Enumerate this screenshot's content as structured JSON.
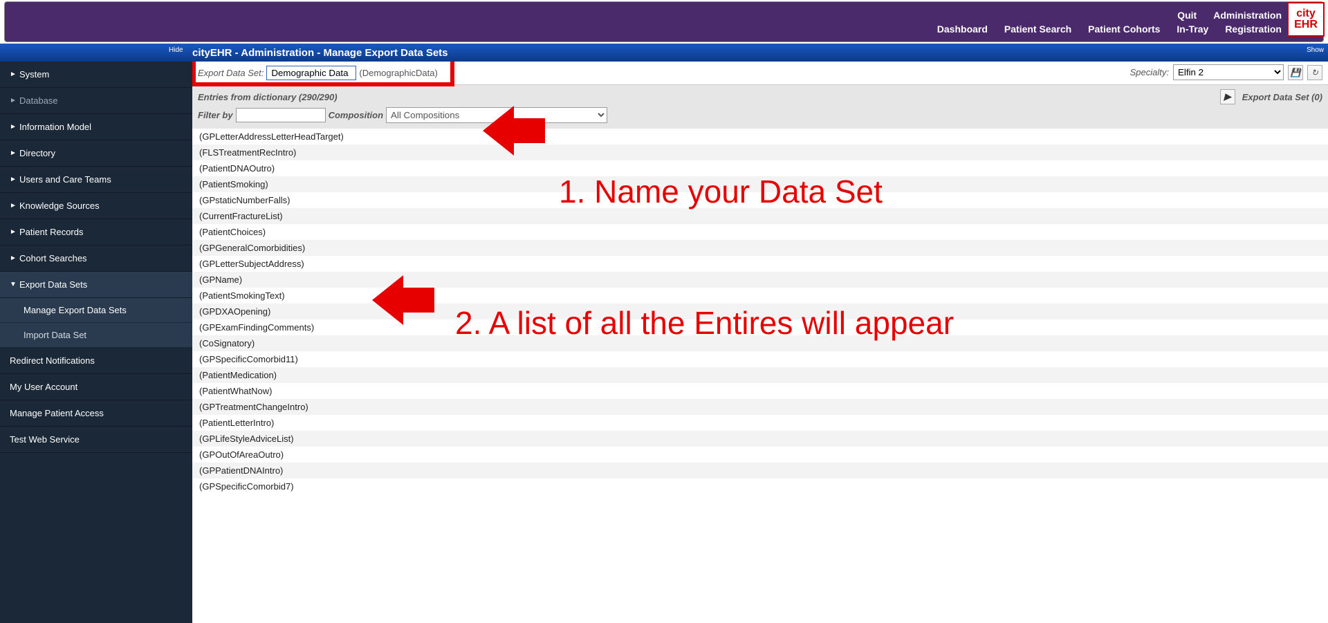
{
  "topbar": {
    "row1": [
      "Quit",
      "Administration"
    ],
    "row2": [
      "Dashboard",
      "Patient Search",
      "Patient Cohorts",
      "In-Tray",
      "Registration"
    ],
    "logo_top": "city",
    "logo_bottom": "EHR"
  },
  "titlebar": {
    "hide": "Hide",
    "show": "Show",
    "title": "cityEHR - Administration - Manage Export Data Sets"
  },
  "sidebar": {
    "menu": [
      {
        "label": "System",
        "tri": "►"
      },
      {
        "label": "Database",
        "tri": "►"
      },
      {
        "label": "Information Model",
        "tri": "►"
      },
      {
        "label": "Directory",
        "tri": "►"
      },
      {
        "label": "Users and Care Teams",
        "tri": "►"
      },
      {
        "label": "Knowledge Sources",
        "tri": "►"
      },
      {
        "label": "Patient Records",
        "tri": "►"
      },
      {
        "label": "Cohort Searches",
        "tri": "►"
      },
      {
        "label": "Export Data Sets",
        "tri": "▼"
      }
    ],
    "sub": [
      "Manage Export Data Sets",
      "Import Data Set"
    ],
    "flat": [
      "Redirect Notifications",
      "My User Account",
      "Manage Patient Access",
      "Test Web Service"
    ]
  },
  "name_row": {
    "label": "Export Data Set:",
    "value": "Demographic Data",
    "id_text": "(DemographicData)",
    "specialty_label": "Specialty:",
    "specialty_value": "Elfin 2"
  },
  "gray_header": {
    "entries_title": "Entries from dictionary (290/290)",
    "filter_label": "Filter by",
    "composition_label": "Composition",
    "composition_value": "All Compositions",
    "export_set_title": "Export Data Set (0)"
  },
  "entries": [
    "(GPLetterAddressLetterHeadTarget)",
    "(FLSTreatmentRecIntro)",
    "(PatientDNAOutro)",
    "(PatientSmoking)",
    "(GPstaticNumberFalls)",
    "(CurrentFractureList)",
    "(PatientChoices)",
    "(GPGeneralComorbidities)",
    "(GPLetterSubjectAddress)",
    "(GPName)",
    "(PatientSmokingText)",
    "(GPDXAOpening)",
    "(GPExamFindingComments)",
    "(CoSignatory)",
    "(GPSpecificComorbid11)",
    "(PatientMedication)",
    "(PatientWhatNow)",
    "(GPTreatmentChangeIntro)",
    "(PatientLetterIntro)",
    "(GPLifeStyleAdviceList)",
    "(GPOutOfAreaOutro)",
    "(GPPatientDNAIntro)",
    "(GPSpecificComorbid7)"
  ],
  "annotations": {
    "text1": "1. Name your Data Set",
    "text2": "2. A list of all the Entires will appear"
  }
}
